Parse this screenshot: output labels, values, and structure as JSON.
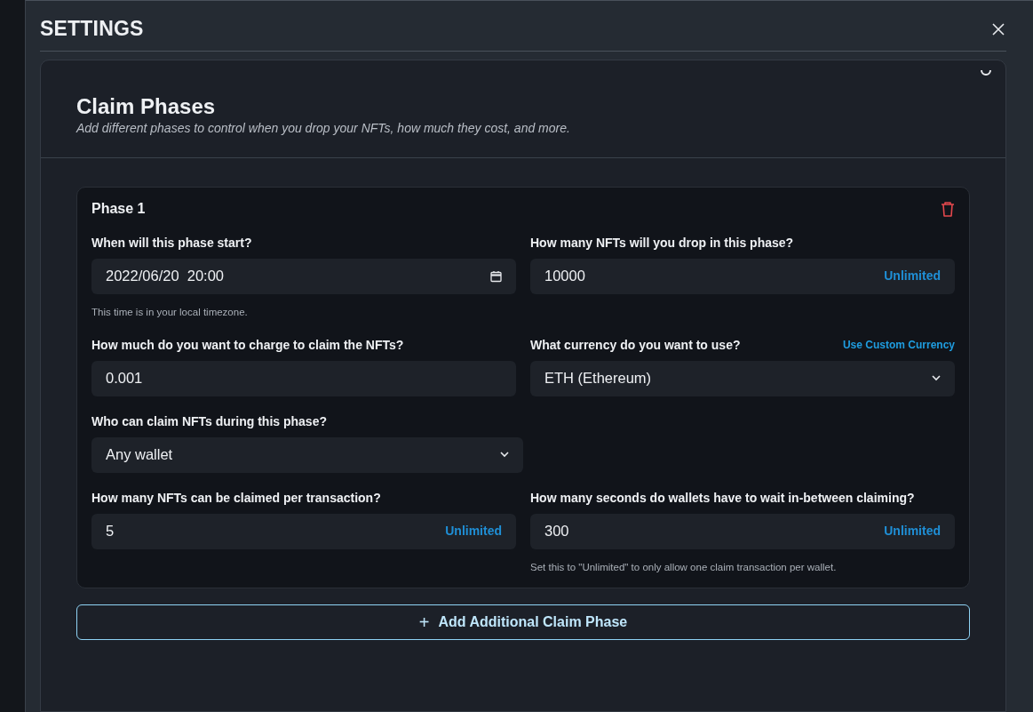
{
  "modal": {
    "title": "SETTINGS"
  },
  "section": {
    "title": "Claim Phases",
    "subtitle": "Add different phases to control when you drop your NFTs, how much they cost, and more."
  },
  "phases": [
    {
      "title": "Phase 1",
      "rows": [
        [
          {
            "kind": "date",
            "label": "When will this phase start?",
            "value": "2022/06/20  20:00",
            "help": "This time is in your local timezone."
          },
          {
            "kind": "number",
            "label": "How many NFTs will you drop in this phase?",
            "value": "10000",
            "action": "Unlimited"
          }
        ],
        [
          {
            "kind": "text",
            "label": "How much do you want to charge to claim the NFTs?",
            "value": "0.001"
          },
          {
            "kind": "select",
            "label": "What currency do you want to use?",
            "label_link": "Use Custom Currency",
            "value": "ETH (Ethereum)"
          }
        ],
        [
          {
            "kind": "select",
            "label": "Who can claim NFTs during this phase?",
            "value": "Any wallet"
          }
        ],
        [
          {
            "kind": "number",
            "label": "How many NFTs can be claimed per transaction?",
            "value": "5",
            "action": "Unlimited"
          },
          {
            "kind": "number",
            "label": "How many seconds do wallets have to wait in-between claiming?",
            "value": "300",
            "action": "Unlimited",
            "help": "Set this to \"Unlimited\" to only allow one claim transaction per wallet."
          }
        ]
      ]
    }
  ],
  "add_button": {
    "icon": "+",
    "label": "Add Additional Claim Phase"
  }
}
